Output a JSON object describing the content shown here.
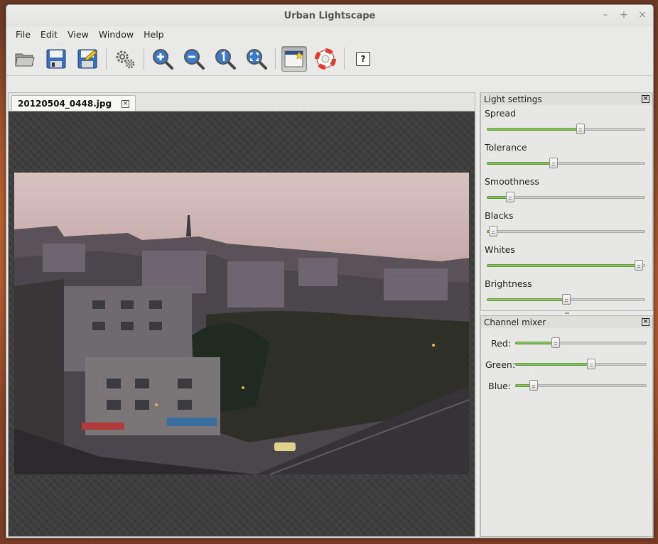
{
  "window": {
    "title": "Urban Lightscape"
  },
  "window_controls": {
    "minimize": "–",
    "maximize": "+",
    "close": "×"
  },
  "menubar": {
    "items": [
      "File",
      "Edit",
      "View",
      "Window",
      "Help"
    ]
  },
  "toolbar": {
    "buttons": [
      {
        "name": "open-folder-icon"
      },
      {
        "name": "save-icon"
      },
      {
        "name": "save-as-icon"
      },
      {
        "name": "settings-gears-icon"
      },
      {
        "name": "zoom-in-icon"
      },
      {
        "name": "zoom-out-icon"
      },
      {
        "name": "zoom-100-icon"
      },
      {
        "name": "zoom-fit-icon"
      },
      {
        "name": "show-original-icon",
        "active": true
      },
      {
        "name": "help-lifebuoy-icon"
      }
    ],
    "whats_this": "?"
  },
  "document": {
    "tab_label": "20120504_0448.jpg",
    "tab_close": "×"
  },
  "light_settings": {
    "title": "Light settings",
    "close": "×",
    "sliders": [
      {
        "label": "Spread",
        "value": 0.59
      },
      {
        "label": "Tolerance",
        "value": 0.42
      },
      {
        "label": "Smoothness",
        "value": 0.15
      },
      {
        "label": "Blacks",
        "value": 0.04
      },
      {
        "label": "Whites",
        "value": 0.96
      },
      {
        "label": "Brightness",
        "value": 0.5
      }
    ]
  },
  "channel_mixer": {
    "title": "Channel mixer",
    "close": "×",
    "sliders": [
      {
        "label": "Red:",
        "value": 0.31
      },
      {
        "label": "Green:",
        "value": 0.58
      },
      {
        "label": "Blue:",
        "value": 0.14
      }
    ]
  },
  "colors": {
    "accent_green": "#7ab650",
    "canvas_bg": "#3e3e3e"
  }
}
